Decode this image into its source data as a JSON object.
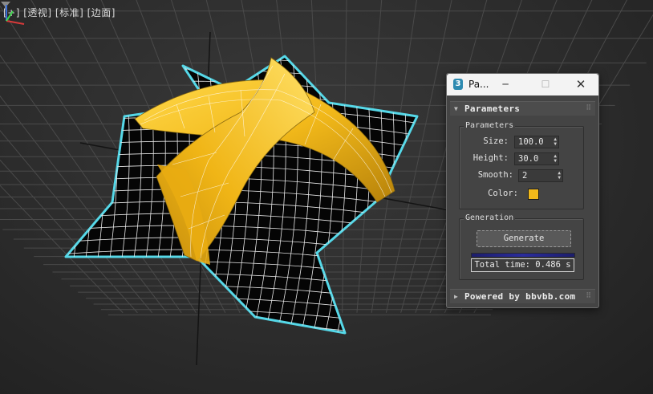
{
  "viewport": {
    "label": "[+] [透视] [标准] [边面]",
    "filter_icon": "funnel-icon",
    "model_color": "#f2b91a",
    "selection_color": "#55d8e8"
  },
  "dialog": {
    "app_icon": "3",
    "title": "Pa...",
    "rollout_parameters": "Parameters",
    "group_parameters": "Parameters",
    "size_label": "Size:",
    "size_value": "100.0",
    "height_label": "Height:",
    "height_value": "30.0",
    "smooth_label": "Smooth:",
    "smooth_value": "2",
    "color_label": "Color:",
    "color_value": "#f2b91a",
    "group_generation": "Generation",
    "generate_label": "Generate",
    "total_time": "Total time: 0.486 s",
    "rollout_powered": "Powered by bbvbb.com"
  }
}
